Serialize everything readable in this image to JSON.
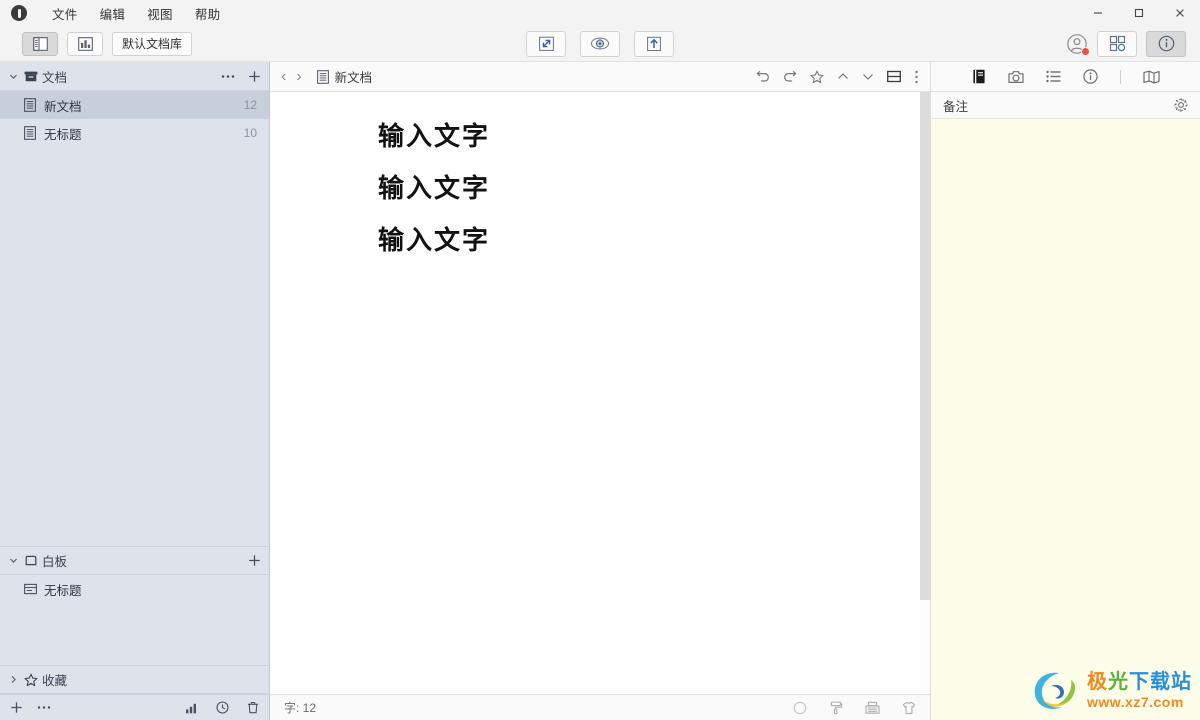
{
  "titlebar": {
    "app_logo": "app-logo-icon",
    "menu": [
      "文件",
      "编辑",
      "视图",
      "帮助"
    ],
    "window_controls": [
      "minimize",
      "maximize",
      "close"
    ]
  },
  "toolbar": {
    "left": [
      {
        "name": "sidebar-toggle",
        "icon": "panel-left-icon",
        "active": true
      },
      {
        "name": "outline-toggle",
        "icon": "bar-chart-icon",
        "active": false
      },
      {
        "name": "library-button",
        "label": "默认文档库",
        "active": false
      }
    ],
    "center": [
      {
        "name": "focus-mode-button",
        "icon": "collapse-arrows-icon"
      },
      {
        "name": "preview-button",
        "icon": "eye-icon"
      },
      {
        "name": "export-button",
        "icon": "upload-icon"
      }
    ],
    "right": [
      {
        "name": "account-avatar",
        "icon": "user-circle-icon",
        "badge": true
      },
      {
        "name": "apps-grid-button",
        "icon": "grid-icon"
      },
      {
        "name": "info-panel-button",
        "icon": "info-circle-icon",
        "active": true
      }
    ]
  },
  "sidebar": {
    "documents": {
      "title": "文档",
      "icon": "archive-box-icon",
      "expanded": true,
      "more_label": "⋯",
      "add_label": "+",
      "items": [
        {
          "label": "新文档",
          "count": "12",
          "icon": "document-icon",
          "selected": true
        },
        {
          "label": "无标题",
          "count": "10",
          "icon": "document-icon",
          "selected": false
        }
      ]
    },
    "whiteboard": {
      "title": "白板",
      "icon": "whiteboard-icon",
      "expanded": true,
      "add_label": "+",
      "items": [
        {
          "label": "无标题",
          "icon": "board-item-icon"
        }
      ]
    },
    "favorites": {
      "title": "收藏",
      "icon": "star-icon",
      "expanded": false
    },
    "footer": {
      "left": [
        {
          "name": "add-button",
          "icon": "plus-icon"
        },
        {
          "name": "more-button",
          "icon": "ellipsis-icon"
        }
      ],
      "right": [
        {
          "name": "stats-button",
          "icon": "bar-chart-icon"
        },
        {
          "name": "history-button",
          "icon": "clock-icon"
        },
        {
          "name": "trash-button",
          "icon": "trash-icon"
        }
      ]
    }
  },
  "document": {
    "header": {
      "back": "‹",
      "forward": "›",
      "icon": "document-icon",
      "title": "新文档",
      "actions": [
        {
          "name": "undo-button",
          "icon": "undo-icon"
        },
        {
          "name": "redo-button",
          "icon": "redo-icon"
        },
        {
          "name": "favorite-button",
          "icon": "star-icon"
        },
        {
          "name": "prev-button",
          "icon": "chevron-up-icon"
        },
        {
          "name": "next-button",
          "icon": "chevron-down-icon"
        },
        {
          "name": "split-view-button",
          "icon": "split-horizontal-icon"
        },
        {
          "name": "more-menu-button",
          "icon": "ellipsis-vertical-icon"
        }
      ]
    },
    "lines": [
      "输入文字",
      "输入文字",
      "输入文字"
    ],
    "status": {
      "word_count_label": "字: 12",
      "icons": [
        {
          "name": "circle-button",
          "icon": "circle-icon"
        },
        {
          "name": "paint-roller-button",
          "icon": "paint-roller-icon"
        },
        {
          "name": "typewriter-button",
          "icon": "typewriter-icon"
        },
        {
          "name": "theme-button",
          "icon": "shirt-icon"
        }
      ]
    }
  },
  "right_panel": {
    "tabs": [
      {
        "name": "notebook-tab",
        "icon": "notebook-icon",
        "active": true
      },
      {
        "name": "snapshot-tab",
        "icon": "camera-icon",
        "active": false
      },
      {
        "name": "outline-tab",
        "icon": "list-icon",
        "active": false
      },
      {
        "name": "info-tab",
        "icon": "info-circle-icon",
        "active": false
      },
      {
        "name": "map-tab",
        "icon": "map-icon",
        "active": false
      }
    ],
    "header_title": "备注",
    "settings_icon": "gear-icon"
  },
  "watermark": {
    "cn_1": "极",
    "cn_2": "光",
    "cn_3": "下载站",
    "url": "www.xz7.com"
  },
  "colors": {
    "sidebar_bg": "#dee2eb",
    "sidebar_selected": "#c7cfdd",
    "notes_bg": "#fdfde9",
    "accent_badge": "#e8504b",
    "toolbar_bg": "#f3f3f3"
  }
}
